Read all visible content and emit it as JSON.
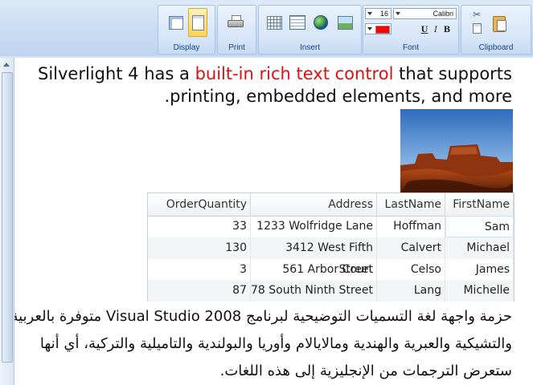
{
  "ribbon": {
    "groups": {
      "display": "Display",
      "print": "Print",
      "insert": "Insert",
      "font": "Font",
      "clipboard": "Clipboard"
    },
    "font_size": "16",
    "font_name": "Calibri",
    "format_buttons": {
      "underline": "U",
      "italic": "I",
      "bold": "B"
    },
    "font_color": "#ff0000"
  },
  "document": {
    "para1_before": "Silverlight 4 has a ",
    "para1_highlight": "built-in rich text control",
    "para1_after": " that supports printing, embedded elements, and more.",
    "highlight_color": "#e01010",
    "grid": {
      "headers": [
        "FirstName",
        "LastName",
        "Address",
        "OrderQuantity"
      ],
      "rows": [
        {
          "first": "Sam",
          "last": "Hoffman",
          "address": "1233 Wolfridge Lane",
          "qty": "33"
        },
        {
          "first": "Michael",
          "last": "Calvert",
          "address": "3412 West Fifth Street",
          "qty": "130"
        },
        {
          "first": "James",
          "last": "Celso",
          "address": "561 Arbor Court",
          "qty": "3"
        },
        {
          "first": "Michelle",
          "last": "Lang",
          "address": "78 South Ninth Street",
          "qty": "87"
        }
      ]
    },
    "para2": "حزمة واجهة لغة التسميات التوضيحية لبرنامج Visual Studio 2008 متوفرة بالعربية والتشيكية والعبرية والهندية ومالايالام وأوريا والبولندية والتاميلية والتركية، أي أنها ستعرض الترجمات من الإنجليزية إلى هذه اللغات."
  }
}
